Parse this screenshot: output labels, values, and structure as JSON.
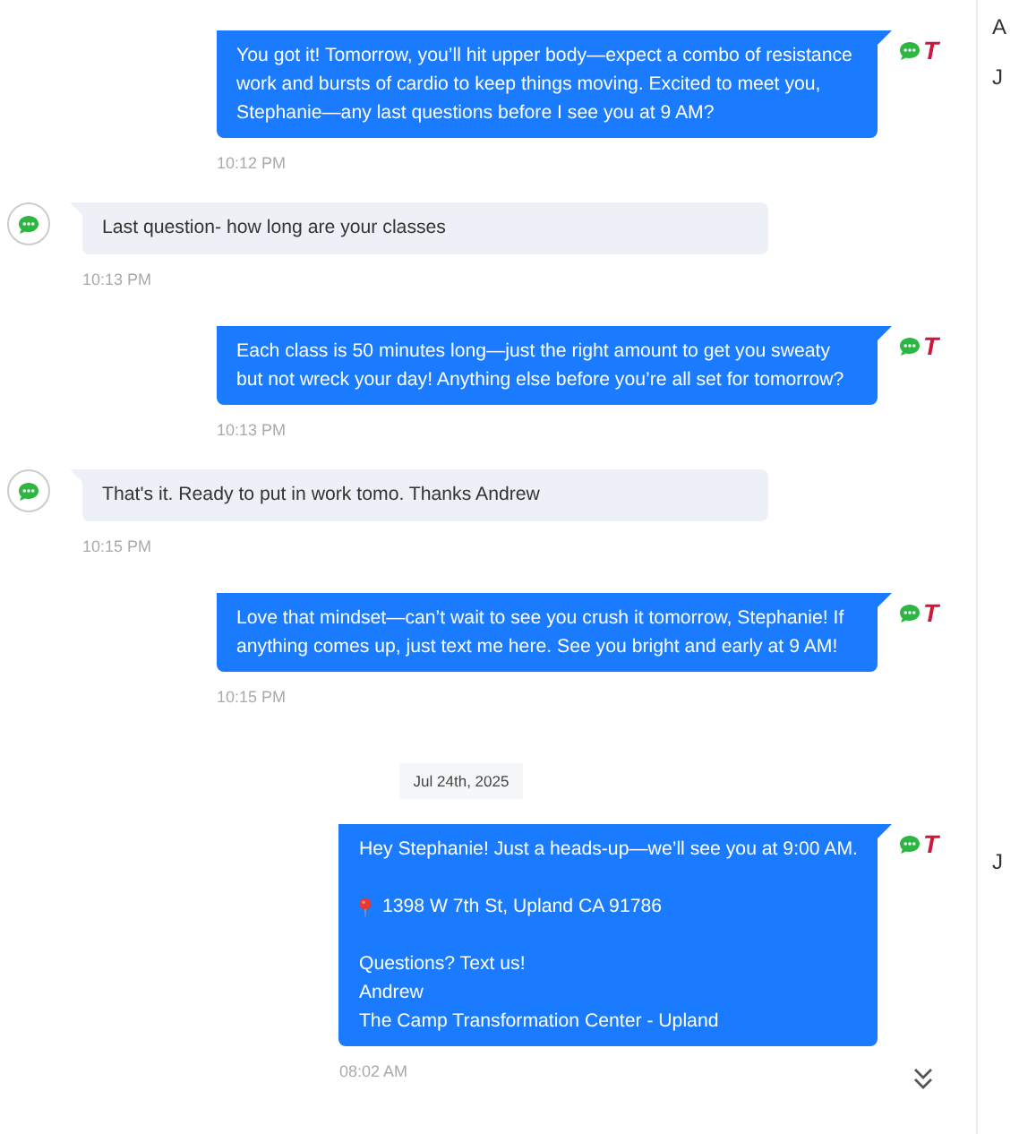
{
  "messages": [
    {
      "kind": "outgoing",
      "channel_mark": "T",
      "blocks": [
        {
          "kind": "text",
          "text": "You got it! Tomorrow, you’ll hit upper body—expect a combo of resistance work and bursts of cardio to keep things moving. Excited to meet you, Stephanie—any last questions before I see you at 9 AM?"
        }
      ],
      "time": "10:12 PM"
    },
    {
      "kind": "incoming",
      "blocks": [
        {
          "kind": "text",
          "text": "Last question- how long are your classes"
        }
      ],
      "time": "10:13 PM"
    },
    {
      "kind": "outgoing",
      "channel_mark": "T",
      "blocks": [
        {
          "kind": "text",
          "text": "Each class is 50 minutes long—just the right amount to get you sweaty but not wreck your day! Anything else before you’re all set for tomorrow?"
        }
      ],
      "time": "10:13 PM"
    },
    {
      "kind": "incoming",
      "blocks": [
        {
          "kind": "text",
          "text": "That's it. Ready to put in work tomo. Thanks Andrew"
        }
      ],
      "time": "10:15 PM"
    },
    {
      "kind": "outgoing",
      "channel_mark": "T",
      "blocks": [
        {
          "kind": "text",
          "text": "Love that mindset—can’t wait to see you crush it tomorrow, Stephanie! If anything comes up, just text me here. See you bright and early at 9 AM!"
        }
      ],
      "time": "10:15 PM"
    },
    {
      "kind": "date",
      "text": "Jul 24th, 2025"
    },
    {
      "kind": "outgoing",
      "channel_mark": "T",
      "blocks": [
        {
          "kind": "text",
          "text": "Hey Stephanie! Just a heads-up—we’ll see you at 9:00 AM."
        },
        {
          "kind": "location",
          "text": "1398 W 7th St, Upland CA 91786"
        },
        {
          "kind": "text",
          "text": "Questions? Text us!\nAndrew\nThe Camp Transformation Center - Upland"
        }
      ],
      "time": "08:02 AM"
    }
  ],
  "side_panel": [
    {
      "text": "A"
    },
    {
      "text": "J"
    },
    {
      "text": "J"
    }
  ]
}
